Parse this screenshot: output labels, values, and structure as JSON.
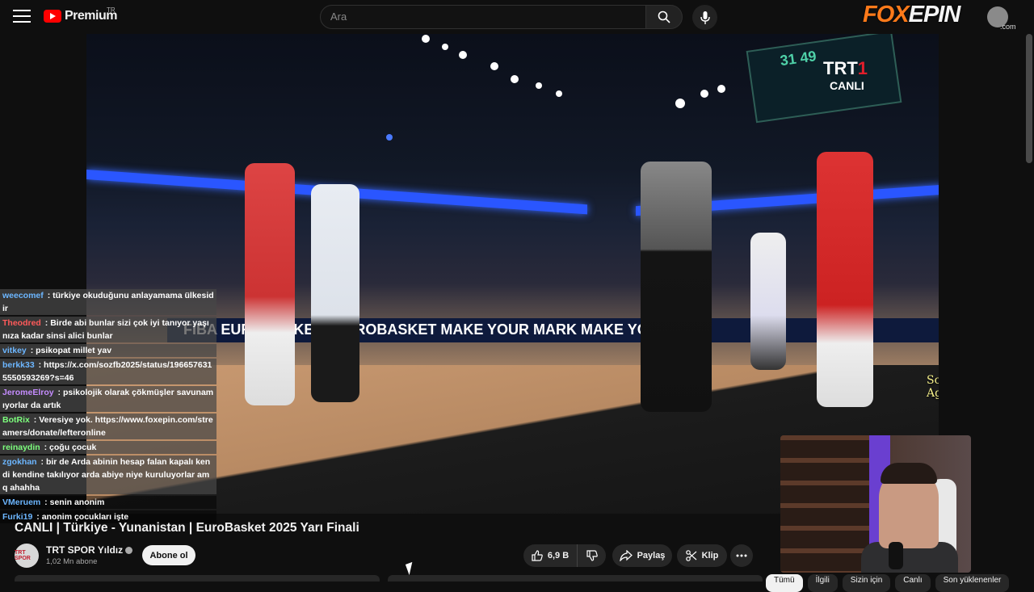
{
  "header": {
    "brand": "Premium",
    "region": "TR",
    "search_placeholder": "Ara",
    "overlay_brand_fx": "FOX",
    "overlay_brand_rest": "EPIN",
    "overlay_brand_domain": ".com"
  },
  "video": {
    "broadcaster": "TRT",
    "broadcaster_num": "1",
    "live_label": "CANLI",
    "scoreboard": "31 49",
    "adboard": "FIBA EUROBASKET   #EUROBASKET   MAKE YOUR MARK   MAKE YOUR M",
    "last_subscriber": "Son abone: AgresifBalon"
  },
  "chat": [
    {
      "user": "weecomef",
      "color": "#6cb6ff",
      "text": "türkiye okuduğunu anlayamama ülkesidir"
    },
    {
      "user": "Theodred",
      "color": "#ff5a5a",
      "text": "Birde abi bunlar sizi çok iyi tanıyor yaşınıza kadar sinsi alici bunlar"
    },
    {
      "user": "vitkey",
      "color": "#6cb6ff",
      "text": "psikopat millet yav"
    },
    {
      "user": "berkk33",
      "color": "#6cb6ff",
      "text": "https://x.com/sozfb2025/status/1966576315550593269?s=46"
    },
    {
      "user": "JeromeElroy",
      "color": "#c58cff",
      "text": "psikolojik olarak çökmüşler savunamıyorlar da artık"
    },
    {
      "user": "BotRix",
      "color": "#7dff7d",
      "text": "Veresiye yok. https://www.foxepin.com/streamers/donate/lefteronline"
    },
    {
      "user": "reinaydin",
      "color": "#7dff7d",
      "text": "çoğu çocuk"
    },
    {
      "user": "zgokhan",
      "color": "#6cb6ff",
      "text": "bir de Arda abinin hesap falan kapalı kendi kendine takılıyor arda abiye niye kuruluyorlar amq ahahha"
    },
    {
      "user": "VMeruem",
      "color": "#6cb6ff",
      "text": "senin anonim"
    },
    {
      "user": "Furki19",
      "color": "#6cb6ff",
      "text": "anonim çocukları işte"
    }
  ],
  "details": {
    "title": "CANLI | Türkiye - Yunanistan | EuroBasket 2025 Yarı Finali",
    "channel_avatar_text": "TRT SPOR",
    "channel_name": "TRT SPOR Yıldız",
    "subscribers": "1,02 Mn abone",
    "subscribe_label": "Abone ol",
    "like_count": "6,9 B",
    "share_label": "Paylaş",
    "clip_label": "Klip"
  },
  "chips": [
    "Tümü",
    "İlgili",
    "Sizin için",
    "Canlı",
    "Son yüklenenler"
  ],
  "colors": {
    "accent": "#ff0000",
    "background": "#0f0f0f",
    "subscriber_text": "#f5f08a"
  }
}
